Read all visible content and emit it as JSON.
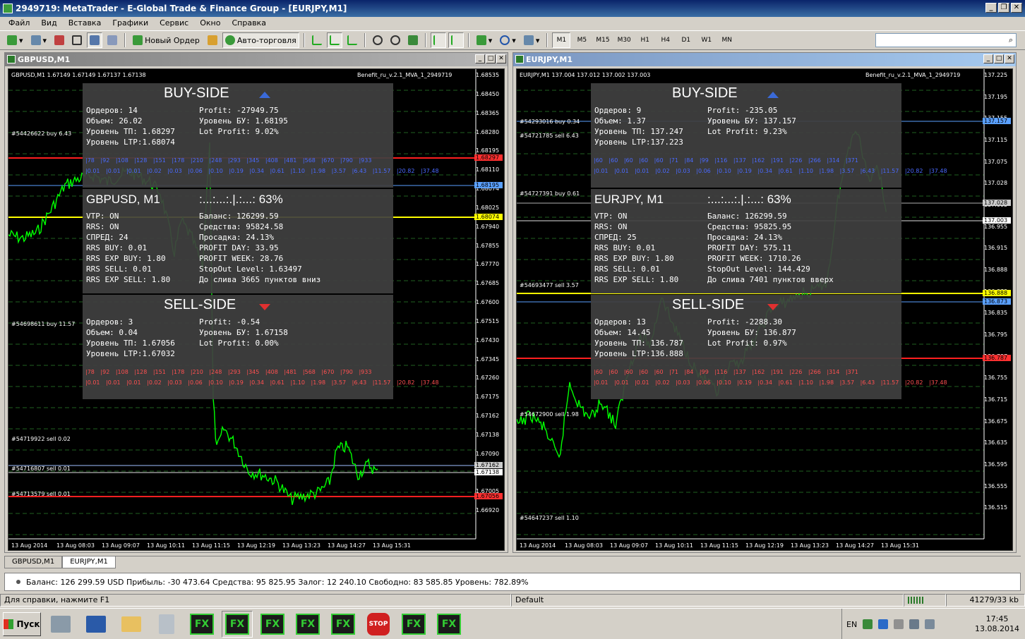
{
  "window": {
    "title": "2949719: MetaTrader - E-Global Trade & Finance Group - [EURJPY,M1]"
  },
  "menu": [
    "Файл",
    "Вид",
    "Вставка",
    "Графики",
    "Сервис",
    "Окно",
    "Справка"
  ],
  "toolbar": {
    "new_order": "Новый Ордер",
    "autotrading": "Авто-торговля",
    "timeframes": [
      "M1",
      "M5",
      "M15",
      "M30",
      "H1",
      "H4",
      "D1",
      "W1",
      "MN"
    ]
  },
  "colors": {
    "bid_line": "#ff0000",
    "buy_line": "#ffff00",
    "grid": "#3a3a3a",
    "price": "#00ff00",
    "panel": "#404040",
    "blue_text": "#4a6aff",
    "red_text": "#ff4040"
  },
  "charts": [
    {
      "window_title": "GBPUSD,M1",
      "header": "GBPUSD,M1  1.67149 1.67149 1.67137 1.67138",
      "ea": "Benefit_ru_v.2.1_MVA_1_2949719",
      "buy": {
        "title": "BUY-SIDE",
        "orders": "Ордеров: 14",
        "profit": "Profit: -27949.75",
        "volume": "Объем: 26.02",
        "be": "Уровень БУ: 1.68195",
        "tp": "Уровень ТП: 1.68297",
        "lotprofit": "Lot Profit: 9.02%",
        "ltp": "Уровень LTP:1.68074",
        "grid1": "|78 |92 |108 |128 |151 |178 |210 |248 |293 |345 |408 |481 |568 |670 |790 |933",
        "grid2": "|0.01 |0.01 |0.01 |0.02 |0.03 |0.06 |0.10 |0.19 |0.34 |0.61 |1.10 |1.98 |3.57 |6.43 |11.57 |20.82 |37.48"
      },
      "info": {
        "title": "GBPUSD, M1",
        "progress": ":...:...:.|.:...: 63%",
        "left": [
          "VTP: ON",
          "RRS: ON",
          "СПРЕД: 24",
          "RRS BUY: 0.01",
          "RRS EXP BUY: 1.80",
          "RRS SELL: 0.01",
          "RRS EXP SELL: 1.80"
        ],
        "right": [
          "Баланс: 126299.59",
          "Средства: 95824.58",
          "Просадка: 24.13%",
          "PROFIT DAY: 33.95",
          "PROFIT WEEK: 28.76",
          "StopOut Level: 1.63497",
          "До слива 3665 пунктов вниз"
        ]
      },
      "sell": {
        "title": "SELL-SIDE",
        "orders": "Ордеров: 3",
        "profit": "Profit: -0.54",
        "volume": "Объем: 0.04",
        "be": "Уровень БУ: 1.67158",
        "tp": "Уровень ТП: 1.67056",
        "lotprofit": "Lot Profit: 0.00%",
        "ltp": "Уровень LTP:1.67032",
        "grid1": "|78 |92 |108 |128 |151 |178 |210 |248 |293 |345 |408 |481 |568 |670 |790 |933",
        "grid2": "|0.01 |0.01 |0.01 |0.02 |0.03 |0.06 |0.10 |0.19 |0.34 |0.61 |1.10 |1.98 |3.57 |6.43 |11.57 |20.82 |37.48"
      },
      "orders": [
        "#54426622 buy 6.43",
        "#54698611 buy 11.57",
        "#54719922 sell 0.02",
        "#54716807 sell 0.01",
        "#54713579 sell 0.01"
      ],
      "y_labels": [
        "1.68535",
        "1.68450",
        "1.68365",
        "1.68280",
        "1.68195",
        "1.68110",
        "1.68074",
        "1.68025",
        "1.67940",
        "1.67855",
        "1.67770",
        "1.67685",
        "1.67600",
        "1.67515",
        "1.67430",
        "1.67345",
        "1.67260",
        "1.67175",
        "1.67162",
        "1.67138",
        "1.67090",
        "1.67056",
        "1.67005",
        "1.66920"
      ],
      "x_labels": [
        "13 Aug 2014",
        "13 Aug 08:03",
        "13 Aug 09:07",
        "13 Aug 10:11",
        "13 Aug 11:15",
        "13 Aug 12:19",
        "13 Aug 13:23",
        "13 Aug 14:27",
        "13 Aug 15:31"
      ],
      "tags": [
        {
          "text": "1.68297",
          "color": "#ff3030"
        },
        {
          "text": "1.68195",
          "color": "#5aa0ff"
        },
        {
          "text": "1.68074",
          "color": "#ffff00"
        },
        {
          "text": "1.67162",
          "color": "#cccccc"
        },
        {
          "text": "1.67138",
          "color": "#ffffff"
        },
        {
          "text": "1.67056",
          "color": "#ff3030"
        }
      ]
    },
    {
      "window_title": "EURJPY,M1",
      "header": "EURJPY,M1  137.004 137.012 137.002 137.003",
      "ea": "Benefit_ru_v.2.1_MVA_1_2949719",
      "buy": {
        "title": "BUY-SIDE",
        "orders": "Ордеров: 9",
        "profit": "Profit: -235.05",
        "volume": "Объем: 1.37",
        "be": "Уровень БУ: 137.157",
        "tp": "Уровень ТП: 137.247",
        "lotprofit": "Lot Profit: 9.23%",
        "ltp": "Уровень LTP:137.223",
        "grid1": "|60 |60 |60 |60 |60 |71 |84 |99 |116 |137 |162 |191 |226 |266 |314 |371",
        "grid2": "|0.01 |0.01 |0.01 |0.02 |0.03 |0.06 |0.10 |0.19 |0.34 |0.61 |1.10 |1.98 |3.57 |6.43 |11.57 |20.82 |37.48"
      },
      "info": {
        "title": "EURJPY, M1",
        "progress": ":...:...:.|.:...: 63%",
        "left": [
          "VTP: ON",
          "RRS: ON",
          "СПРЕД: 25",
          "RRS BUY: 0.01",
          "RRS EXP BUY: 1.80",
          "RRS SELL: 0.01",
          "RRS EXP SELL: 1.80"
        ],
        "right": [
          "Баланс: 126299.59",
          "Средства: 95825.95",
          "Просадка: 24.13%",
          "PROFIT DAY: 575.11",
          "PROFIT WEEK: 1710.26",
          "StopOut Level: 144.429",
          "До слива 7401 пунктов вверх"
        ]
      },
      "sell": {
        "title": "SELL-SIDE",
        "orders": "Ордеров: 13",
        "profit": "Profit: -2288.30",
        "volume": "Объем: 14.45",
        "be": "Уровень БУ: 136.877",
        "tp": "Уровень ТП: 136.787",
        "lotprofit": "Lot Profit: 0.97%",
        "ltp": "Уровень LTP:136.888",
        "grid1": "|60 |60 |60 |60 |60 |71 |84 |99 |116 |137 |162 |191 |226 |266 |314 |371",
        "grid2": "|0.01 |0.01 |0.01 |0.02 |0.03 |0.06 |0.10 |0.19 |0.34 |0.61 |1.10 |1.98 |3.57 |6.43 |11.57 |20.82 |37.48"
      },
      "orders": [
        "#54293016 buy 0.34",
        "#54721785 sell 6.43",
        "#54727391 buy 0.61",
        "#54693477 sell 3.57",
        "#54672900 sell 1.98",
        "#54647237 sell 1.10"
      ],
      "y_labels": [
        "137.225",
        "137.195",
        "137.155",
        "137.115",
        "137.075",
        "137.028",
        "137.003",
        "136.955",
        "136.915",
        "136.888",
        "136.873",
        "136.835",
        "136.795",
        "136.787",
        "136.755",
        "136.715",
        "136.675",
        "136.635",
        "136.595",
        "136.555",
        "136.515"
      ],
      "x_labels": [
        "13 Aug 2014",
        "13 Aug 08:03",
        "13 Aug 09:07",
        "13 Aug 10:11",
        "13 Aug 11:15",
        "13 Aug 12:19",
        "13 Aug 13:23",
        "13 Aug 14:27",
        "13 Aug 15:31"
      ],
      "tags": [
        {
          "text": "137.157",
          "color": "#5aa0ff"
        },
        {
          "text": "137.028",
          "color": "#cccccc"
        },
        {
          "text": "137.003",
          "color": "#ffffff"
        },
        {
          "text": "136.888",
          "color": "#ffff00"
        },
        {
          "text": "136.873",
          "color": "#5aa0ff"
        },
        {
          "text": "136.787",
          "color": "#ff3030"
        }
      ]
    }
  ],
  "tabs": [
    "GBPUSD,M1",
    "EURJPY,M1"
  ],
  "terminal": "Баланс: 126 299.59 USD  Прибыль: -30 473.64  Средства: 95 825.95  Залог: 12 240.10  Свободно: 83 585.85  Уровень: 782.89%",
  "status": {
    "help": "Для справки, нажмите F1",
    "profile": "Default",
    "traffic": "41279/33 kb"
  },
  "taskbar": {
    "start": "Пуск",
    "lang": "EN",
    "time": "17:45",
    "date": "13.08.2014",
    "stop": "STOP",
    "fx": "FX"
  }
}
